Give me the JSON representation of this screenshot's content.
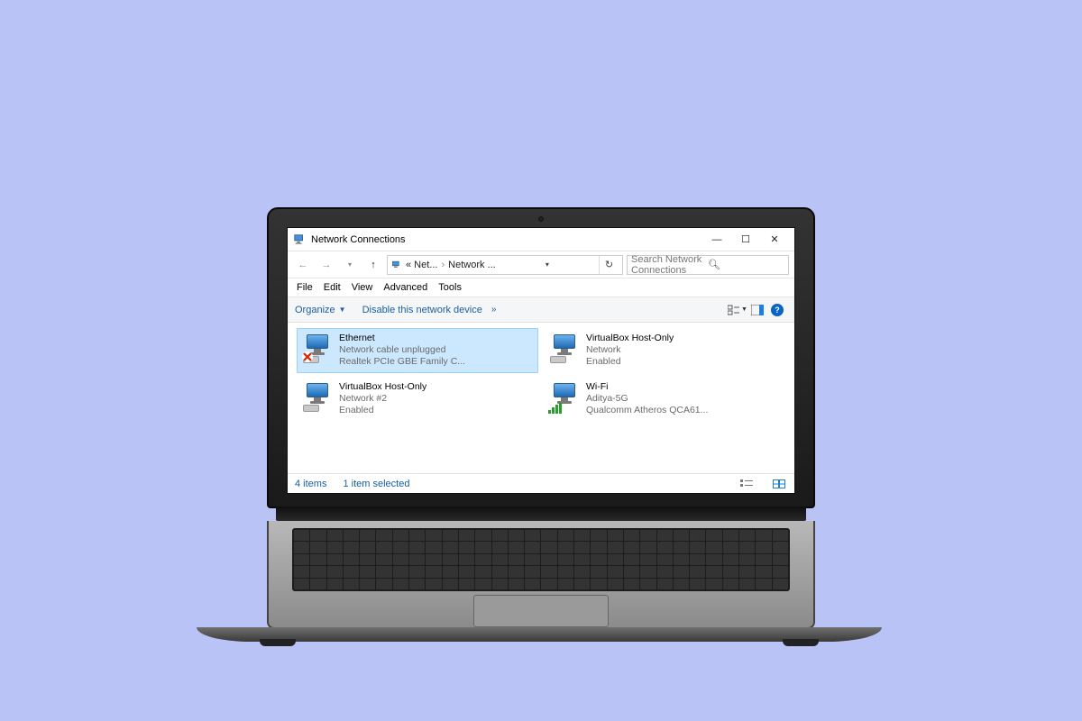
{
  "window": {
    "title": "Network Connections",
    "minimize": "—",
    "maximize": "☐",
    "close": "✕"
  },
  "address": {
    "crumb1": "« Net...",
    "crumb2": "Network ...",
    "search_placeholder": "Search Network Connections"
  },
  "menu": {
    "file": "File",
    "edit": "Edit",
    "view": "View",
    "advanced": "Advanced",
    "tools": "Tools"
  },
  "cmdbar": {
    "organize": "Organize",
    "disable": "Disable this network device",
    "more": "»"
  },
  "connections": [
    {
      "name": "Ethernet",
      "status": "Network cable unplugged",
      "detail": "Realtek PCIe GBE Family C...",
      "selected": true,
      "type": "wired-error"
    },
    {
      "name": "VirtualBox Host-Only",
      "status": "Network",
      "detail": "Enabled",
      "selected": false,
      "type": "wired"
    },
    {
      "name": "VirtualBox Host-Only",
      "status": "Network #2",
      "detail": "Enabled",
      "selected": false,
      "type": "wired"
    },
    {
      "name": "Wi-Fi",
      "status": "Aditya-5G",
      "detail": "Qualcomm Atheros QCA61...",
      "selected": false,
      "type": "wifi"
    }
  ],
  "statusbar": {
    "count": "4 items",
    "selected": "1 item selected"
  }
}
